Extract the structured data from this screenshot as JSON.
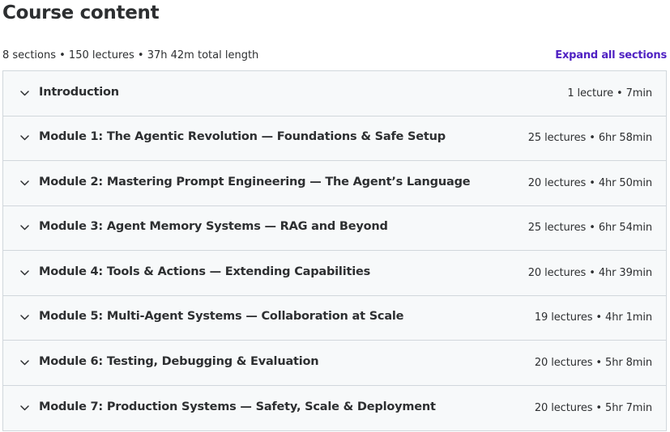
{
  "header": {
    "title": "Course content",
    "summary": "8 sections • 150 lectures • 37h 42m total length",
    "expand_all_label": "Expand all sections"
  },
  "colors": {
    "accent": "#5022c3",
    "section_bg": "#f7f9fa",
    "border": "#d1d7dc",
    "text": "#2d2f31"
  },
  "sections": [
    {
      "title": "Introduction",
      "meta": "1 lecture • 7min",
      "icon": "chevron-down-icon"
    },
    {
      "title": "Module 1: The Agentic Revolution — Foundations & Safe Setup",
      "meta": "25 lectures • 6hr 58min",
      "icon": "chevron-down-icon"
    },
    {
      "title": "Module 2: Mastering Prompt Engineering — The Agent’s Language",
      "meta": "20 lectures • 4hr 50min",
      "icon": "chevron-down-icon"
    },
    {
      "title": "Module 3: Agent Memory Systems — RAG and Beyond",
      "meta": "25 lectures • 6hr 54min",
      "icon": "chevron-down-icon"
    },
    {
      "title": "Module 4: Tools & Actions — Extending Capabilities",
      "meta": "20 lectures • 4hr 39min",
      "icon": "chevron-down-icon"
    },
    {
      "title": "Module 5: Multi-Agent Systems — Collaboration at Scale",
      "meta": "19 lectures • 4hr 1min",
      "icon": "chevron-down-icon"
    },
    {
      "title": "Module 6: Testing, Debugging & Evaluation",
      "meta": "20 lectures • 5hr 8min",
      "icon": "chevron-down-icon"
    },
    {
      "title": "Module 7: Production Systems — Safety, Scale & Deployment",
      "meta": "20 lectures • 5hr 7min",
      "icon": "chevron-down-icon"
    }
  ]
}
